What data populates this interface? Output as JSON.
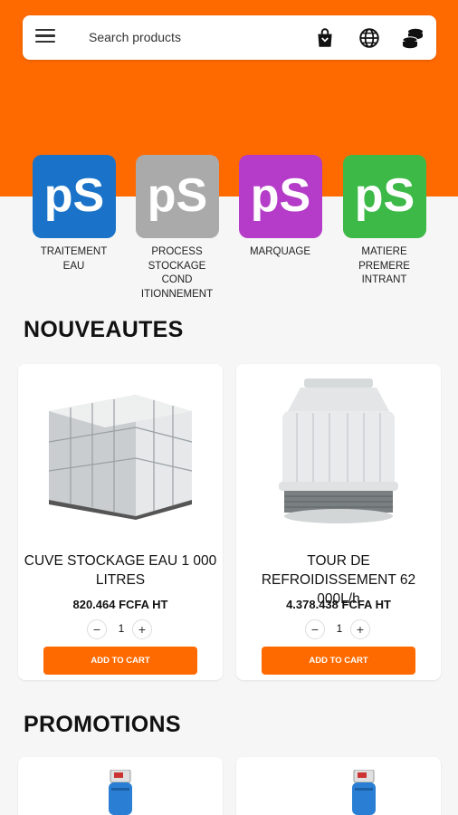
{
  "colors": {
    "accent": "#ff6a00",
    "blue": "#1a73c8",
    "gray": "#aaaaaa",
    "purple": "#b43cc8",
    "green": "#3cb946"
  },
  "search": {
    "placeholder": "Search products"
  },
  "header_icons": [
    "menu-icon",
    "shopping-bag-icon",
    "globe-icon",
    "coins-icon"
  ],
  "categories": [
    {
      "logo_text": "pS",
      "label": "TRAITEMENT EAU"
    },
    {
      "logo_text": "pS",
      "label": "PROCESS STOCKAGE COND ITIONNEMENT"
    },
    {
      "logo_text": "pS",
      "label": "MARQUAGE"
    },
    {
      "logo_text": "pS",
      "label": "MATIERE PREMERE INTRANT"
    }
  ],
  "sections": {
    "new": "NOUVEAUTES",
    "promo": "PROMOTIONS"
  },
  "products": [
    {
      "name": "CUVE STOCKAGE EAU 1 000 LITRES",
      "price": "820.464 FCFA HT",
      "qty": "1",
      "add_label": "ADD TO CART"
    },
    {
      "name": "TOUR DE REFROIDISSEMENT 62 000L/h",
      "price": "4.378.438 FCFA HT",
      "qty": "1",
      "add_label": "ADD TO CART"
    }
  ],
  "qty_controls": {
    "minus": "−",
    "plus": "+"
  }
}
